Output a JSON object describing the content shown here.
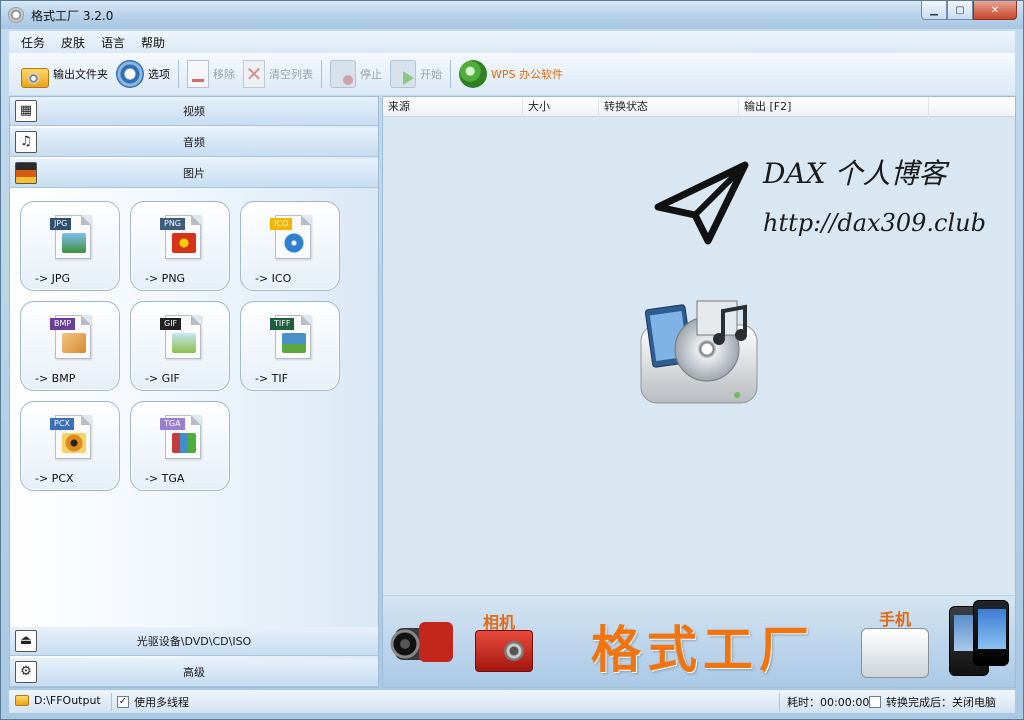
{
  "window": {
    "title": "格式工厂 3.2.0",
    "minimize_glyph": "▁",
    "maximize_glyph": "▢",
    "close_glyph": "✕"
  },
  "menu": {
    "items": [
      "任务",
      "皮肤",
      "语言",
      "帮助"
    ]
  },
  "toolbar": {
    "output_folder": "输出文件夹",
    "options": "选项",
    "remove": "移除",
    "clear_list": "清空列表",
    "stop": "停止",
    "start": "开始",
    "wps": "WPS 办公软件"
  },
  "categories": {
    "video": "视频",
    "audio": "音频",
    "image": "图片",
    "rom": "光驱设备\\DVD\\CD\\ISO",
    "advanced": "高级"
  },
  "formats": [
    {
      "tag": "JPG",
      "label": "-> JPG",
      "tag_color": "#2f4f6f",
      "pic_color": "#5aa0d8"
    },
    {
      "tag": "PNG",
      "label": "-> PNG",
      "tag_color": "#3c5d7c",
      "pic_color": "#d8331a"
    },
    {
      "tag": "ICO",
      "label": "-> ICO",
      "tag_color": "#f4b400",
      "pic_color": "#2f7fd0"
    },
    {
      "tag": "BMP",
      "label": "-> BMP",
      "tag_color": "#6a3d9a",
      "pic_color": "#d8892b"
    },
    {
      "tag": "GIF",
      "label": "-> GIF",
      "tag_color": "#222222",
      "pic_color": "#8bbf4a"
    },
    {
      "tag": "TIFF",
      "label": "-> TIF",
      "tag_color": "#1f5f3f",
      "pic_color": "#4a90c8"
    },
    {
      "tag": "PCX",
      "label": "-> PCX",
      "tag_color": "#3b6fb6",
      "pic_color": "#e08a1b"
    },
    {
      "tag": "TGA",
      "label": "-> TGA",
      "tag_color": "#9b7fcf",
      "pic_color": "#c33d3d"
    }
  ],
  "file_list": {
    "columns": [
      "来源",
      "大小",
      "转换状态",
      "输出 [F2]"
    ]
  },
  "watermark": {
    "title": "DAX 个人博客",
    "url": "http://dax309.club"
  },
  "banner": {
    "camera_label": "相机",
    "main_text": "格式工厂",
    "phone_label": "手机"
  },
  "status": {
    "output_path": "D:\\FFOutput",
    "multithread_checked": "✓",
    "multithread_label": "使用多线程",
    "elapsed": "耗时：00:00:00",
    "after_done": "转换完成后：关闭电脑"
  },
  "colors": {
    "accent_orange": "#f07412",
    "panel_blue": "#d9e7f3"
  }
}
